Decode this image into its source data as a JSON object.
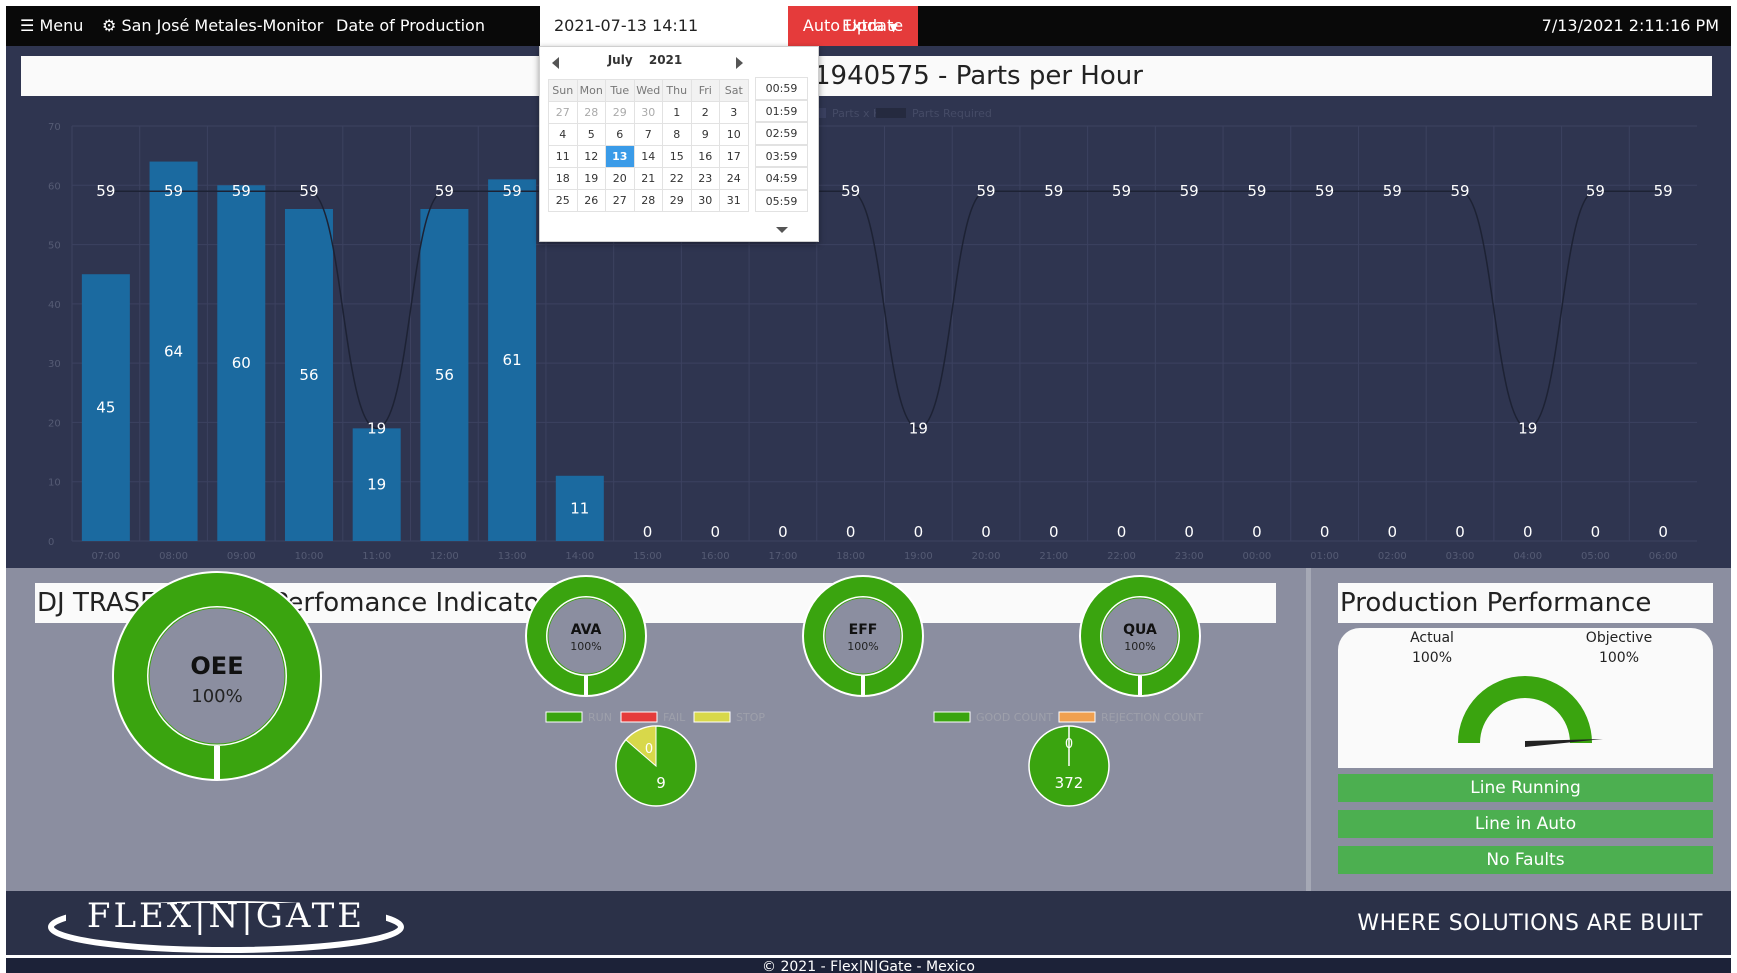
{
  "topbar": {
    "menu_label": "Menu",
    "monitor_label": "San José Metales-Monitor",
    "date_label": "Date of Production",
    "date_value": "2021-07-13 14:11",
    "autoupdate_label": "Auto Update",
    "extra_label": "Extra",
    "clock": "7/13/2021 2:11:16 PM"
  },
  "calendar": {
    "month": "July",
    "year": "2021",
    "weekdays": [
      "Sun",
      "Mon",
      "Tue",
      "Wed",
      "Thu",
      "Fri",
      "Sat"
    ],
    "weeks": [
      [
        "27",
        "28",
        "29",
        "30",
        "1",
        "2",
        "3"
      ],
      [
        "4",
        "5",
        "6",
        "7",
        "8",
        "9",
        "10"
      ],
      [
        "11",
        "12",
        "13",
        "14",
        "15",
        "16",
        "17"
      ],
      [
        "18",
        "19",
        "20",
        "21",
        "22",
        "23",
        "24"
      ],
      [
        "25",
        "26",
        "27",
        "28",
        "29",
        "30",
        "31"
      ]
    ],
    "selected_day": "13",
    "times": [
      "00:59",
      "01:59",
      "02:59",
      "03:59",
      "04:59",
      "05:59"
    ]
  },
  "chart_title": "1940575 - Parts per Hour",
  "chart_data": {
    "type": "bar",
    "legend": [
      "Parts x Hour",
      "Parts Required"
    ],
    "categories": [
      "07:00",
      "08:00",
      "09:00",
      "10:00",
      "11:00",
      "12:00",
      "13:00",
      "14:00",
      "15:00",
      "16:00",
      "17:00",
      "18:00",
      "19:00",
      "20:00",
      "21:00",
      "22:00",
      "23:00",
      "00:00",
      "01:00",
      "02:00",
      "03:00",
      "04:00",
      "05:00",
      "06:00"
    ],
    "series": [
      {
        "name": "Parts x Hour",
        "type": "bar",
        "values": [
          45,
          64,
          60,
          56,
          19,
          56,
          61,
          11,
          0,
          0,
          0,
          0,
          0,
          0,
          0,
          0,
          0,
          0,
          0,
          0,
          0,
          0,
          0,
          0
        ]
      },
      {
        "name": "Parts Required",
        "type": "line",
        "values": [
          59,
          59,
          59,
          59,
          19,
          59,
          59,
          59,
          59,
          59,
          59,
          59,
          19,
          59,
          59,
          59,
          59,
          59,
          59,
          59,
          59,
          19,
          59,
          59
        ]
      }
    ],
    "yticks": [
      "0",
      "10",
      "20",
      "30",
      "40",
      "50",
      "60",
      "70"
    ],
    "ylim": [
      0,
      70
    ]
  },
  "kpi": {
    "title": "DJ TRASERA - Key Perfomance Indicators (KPI)",
    "oee_label": "OEE",
    "oee_value": "100%",
    "ava_label": "AVA",
    "ava_value": "100%",
    "eff_label": "EFF",
    "eff_value": "100%",
    "qua_label": "QUA",
    "qua_value": "100%",
    "legend_run": "RUN",
    "legend_fail": "FAIL",
    "legend_stop": "STOP",
    "legend_good": "GOOD COUNT",
    "legend_reject": "REJECTION COUNT",
    "pie1_main": "9",
    "pie1_small": "0",
    "pie2_main": "372",
    "pie2_small": "0"
  },
  "performance": {
    "title": "Production Performance",
    "actual_label": "Actual",
    "actual_value": "100%",
    "objective_label": "Objective",
    "objective_value": "100%",
    "status_1": "Line Running",
    "status_2": "Line in Auto",
    "status_3": "No Faults"
  },
  "footer": {
    "logo": "FLEX|N|GATE",
    "slogan": "WHERE SOLUTIONS ARE BUILT",
    "copyright": "© 2021 - Flex|N|Gate - Mexico"
  },
  "colors": {
    "bar": "#1b6aa0",
    "green": "#3aa40f",
    "red_button": "#e53b3b",
    "status_green": "#4caf50",
    "selected_day": "#3a9be8"
  }
}
